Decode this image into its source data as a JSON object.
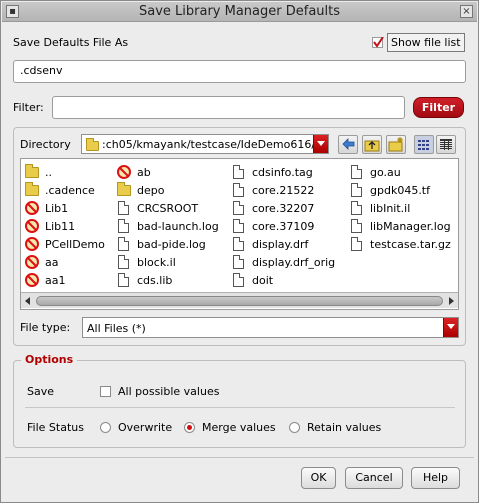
{
  "window": {
    "title": "Save Library Manager Defaults"
  },
  "save_as": {
    "label": "Save Defaults File As",
    "value": ".cdsenv",
    "show_file_list_label": "Show file list",
    "show_file_list_checked": true
  },
  "filter": {
    "label": "Filter:",
    "value": "",
    "button_label": "Filter"
  },
  "browser": {
    "directory_label": "Directory",
    "directory_value": ":ch05/kmayank/testcase/IdeDemo616/",
    "files": [
      {
        "name": "..",
        "icon": "folder-icon"
      },
      {
        "name": ".cadence",
        "icon": "folder-icon"
      },
      {
        "name": "Lib1",
        "icon": "no-access-icon"
      },
      {
        "name": "Lib11",
        "icon": "no-access-icon"
      },
      {
        "name": "PCellDemo",
        "icon": "no-access-icon"
      },
      {
        "name": "aa",
        "icon": "no-access-icon"
      },
      {
        "name": "aa1",
        "icon": "no-access-icon"
      },
      {
        "name": "ab",
        "icon": "no-access-icon"
      },
      {
        "name": "depo",
        "icon": "folder-icon"
      },
      {
        "name": "CRCSROOT",
        "icon": "file-icon"
      },
      {
        "name": "bad-launch.log",
        "icon": "file-icon"
      },
      {
        "name": "bad-pide.log",
        "icon": "file-icon"
      },
      {
        "name": "block.il",
        "icon": "file-icon"
      },
      {
        "name": "cds.lib",
        "icon": "file-icon"
      },
      {
        "name": "cdsinfo.tag",
        "icon": "file-icon"
      },
      {
        "name": "core.21522",
        "icon": "file-icon"
      },
      {
        "name": "core.32207",
        "icon": "file-icon"
      },
      {
        "name": "core.37109",
        "icon": "file-icon"
      },
      {
        "name": "display.drf",
        "icon": "file-icon"
      },
      {
        "name": "display.drf_orig",
        "icon": "file-icon"
      },
      {
        "name": "doit",
        "icon": "file-icon"
      },
      {
        "name": "go.au",
        "icon": "file-icon"
      },
      {
        "name": "gpdk045.tf",
        "icon": "file-icon"
      },
      {
        "name": "libInit.il",
        "icon": "file-icon"
      },
      {
        "name": "libManager.log",
        "icon": "file-icon"
      },
      {
        "name": "testcase.tar.gz",
        "icon": "file-icon"
      }
    ],
    "file_type_label": "File type:",
    "file_type_value": "All Files (*)"
  },
  "options": {
    "title": "Options",
    "save_label": "Save",
    "all_possible_values_label": "All possible values",
    "all_possible_values_checked": false,
    "file_status_label": "File Status",
    "file_status_options": [
      "Overwrite",
      "Merge values",
      "Retain values"
    ],
    "file_status_selected": "Merge values"
  },
  "buttons": {
    "ok": "OK",
    "cancel": "Cancel",
    "help": "Help"
  },
  "colors": {
    "accent": "#c0141c",
    "background": "#ececec"
  }
}
